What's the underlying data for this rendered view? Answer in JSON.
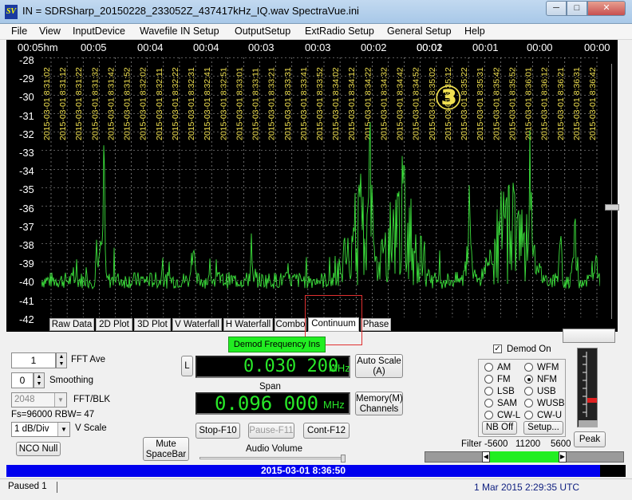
{
  "window": {
    "title": "IN = SDRSharp_20150228_233052Z_437417kHz_IQ.wav    SpectraVue.ini",
    "app_icon": "SV",
    "min_glyph": "─",
    "max_glyph": "□",
    "close_glyph": "✕"
  },
  "menu": [
    "File",
    "View",
    "InputDevice",
    "Wavefile IN Setup",
    "OutputSetup",
    "ExtRadio Setup",
    "General Setup",
    "Help"
  ],
  "time_axis": [
    "00:05hm",
    "00:05",
    "00:04",
    "00:04",
    "00:03",
    "00:03",
    "00:02",
    "00:02",
    "00:01",
    "00:01",
    "00:00",
    "00:00"
  ],
  "y_axis": [
    "-28",
    "-29",
    "-30",
    "-31",
    "-32",
    "-33",
    "-34",
    "-35",
    "-36",
    "-37",
    "-38",
    "-39",
    "-40",
    "-41",
    "-42"
  ],
  "timestamps": [
    "2015-03-01 8:31:02",
    "2015-03-01 8:31:12",
    "2015-03-01 8:31:22",
    "2015-03-01 8:31:32",
    "2015-03-01 8:31:42",
    "2015-03-01 8:31:52",
    "2015-03-01 8:32:02",
    "2015-03-01 8:32:11",
    "2015-03-01 8:32:22",
    "2015-03-01 8:32:31",
    "2015-03-01 8:32:41",
    "2015-03-01 8:32:51",
    "2015-03-01 8:33:01",
    "2015-03-01 8:33:11",
    "2015-03-01 8:33:21",
    "2015-03-01 8:33:31",
    "2015-03-01 8:33:41",
    "2015-03-01 8:33:52",
    "2015-03-01 8:34:02",
    "2015-03-01 8:34:12",
    "2015-03-01 8:34:22",
    "2015-03-01 8:34:32",
    "2015-03-01 8:34:42",
    "2015-03-01 8:34:52",
    "2015-03-01 8:35:02",
    "2015-03-01 8:35:12",
    "2015-03-01 8:35:22",
    "2015-03-01 8:35:31",
    "2015-03-01 8:35:42",
    "2015-03-01 8:35:52",
    "2015-03-01 8:36:01",
    "2015-03-01 8:36:12",
    "2015-03-01 8:36:21",
    "2015-03-01 8:36:31",
    "2015-03-01 8:36:42"
  ],
  "annotation": "③",
  "tabs": [
    "Raw Data",
    "2D Plot",
    "3D Plot",
    "V Waterfall",
    "H Waterfall",
    "Combo",
    "Continuum",
    "Phase"
  ],
  "active_tab": "Continuum",
  "demod_freq_button": "Demod Frequency   Ins",
  "fft_ave": {
    "value": "1",
    "label": "FFT Ave"
  },
  "smoothing": {
    "value": "0",
    "label": "Smoothing"
  },
  "fft_blk": {
    "value": "2048",
    "label": "FFT/BLK"
  },
  "fs_rbw": "Fs=96000 RBW=  47",
  "vscale": {
    "value": "1 dB/Div",
    "label": "V Scale"
  },
  "nco_null": "NCO Null",
  "l_button": "L",
  "demod_freq_value": "0.030 200",
  "demod_freq_unit": "MHz",
  "auto_scale": [
    "Auto Scale",
    "(A)"
  ],
  "span_label": "Span",
  "span_value": "0.096 000",
  "span_unit": "MHz",
  "memory_channels": [
    "Memory(M)",
    "Channels"
  ],
  "stop_btn": "Stop-F10",
  "pause_btn": "Pause-F11",
  "cont_btn": "Cont-F12",
  "mute_btn": [
    "Mute",
    "SpaceBar"
  ],
  "audio_volume": "Audio Volume",
  "demod_on": {
    "label": "Demod On",
    "checked": true
  },
  "demod_modes": [
    {
      "label": "AM",
      "on": false
    },
    {
      "label": "WFM",
      "on": false
    },
    {
      "label": "FM",
      "on": false
    },
    {
      "label": "NFM",
      "on": true
    },
    {
      "label": "LSB",
      "on": false
    },
    {
      "label": "USB",
      "on": false
    },
    {
      "label": "SAM",
      "on": false
    },
    {
      "label": "WUSB",
      "on": false
    },
    {
      "label": "CW-L",
      "on": false
    },
    {
      "label": "CW-U",
      "on": false
    }
  ],
  "nb_off": "NB Off",
  "setup_btn": "Setup...",
  "peak_btn": "Peak",
  "filter": {
    "label": "Filter",
    "low": "-5600",
    "width": "11200",
    "high": "5600"
  },
  "status_datetime": "2015-03-01  8:36:50",
  "status_left": "Paused 1",
  "status_right": "1 Mar 2015  2:29:35 UTC",
  "colors": {
    "trace": "#3ce03c",
    "grid": "#b0b0b0",
    "timestamp": "#f0e050",
    "lcd": "#28e828"
  }
}
